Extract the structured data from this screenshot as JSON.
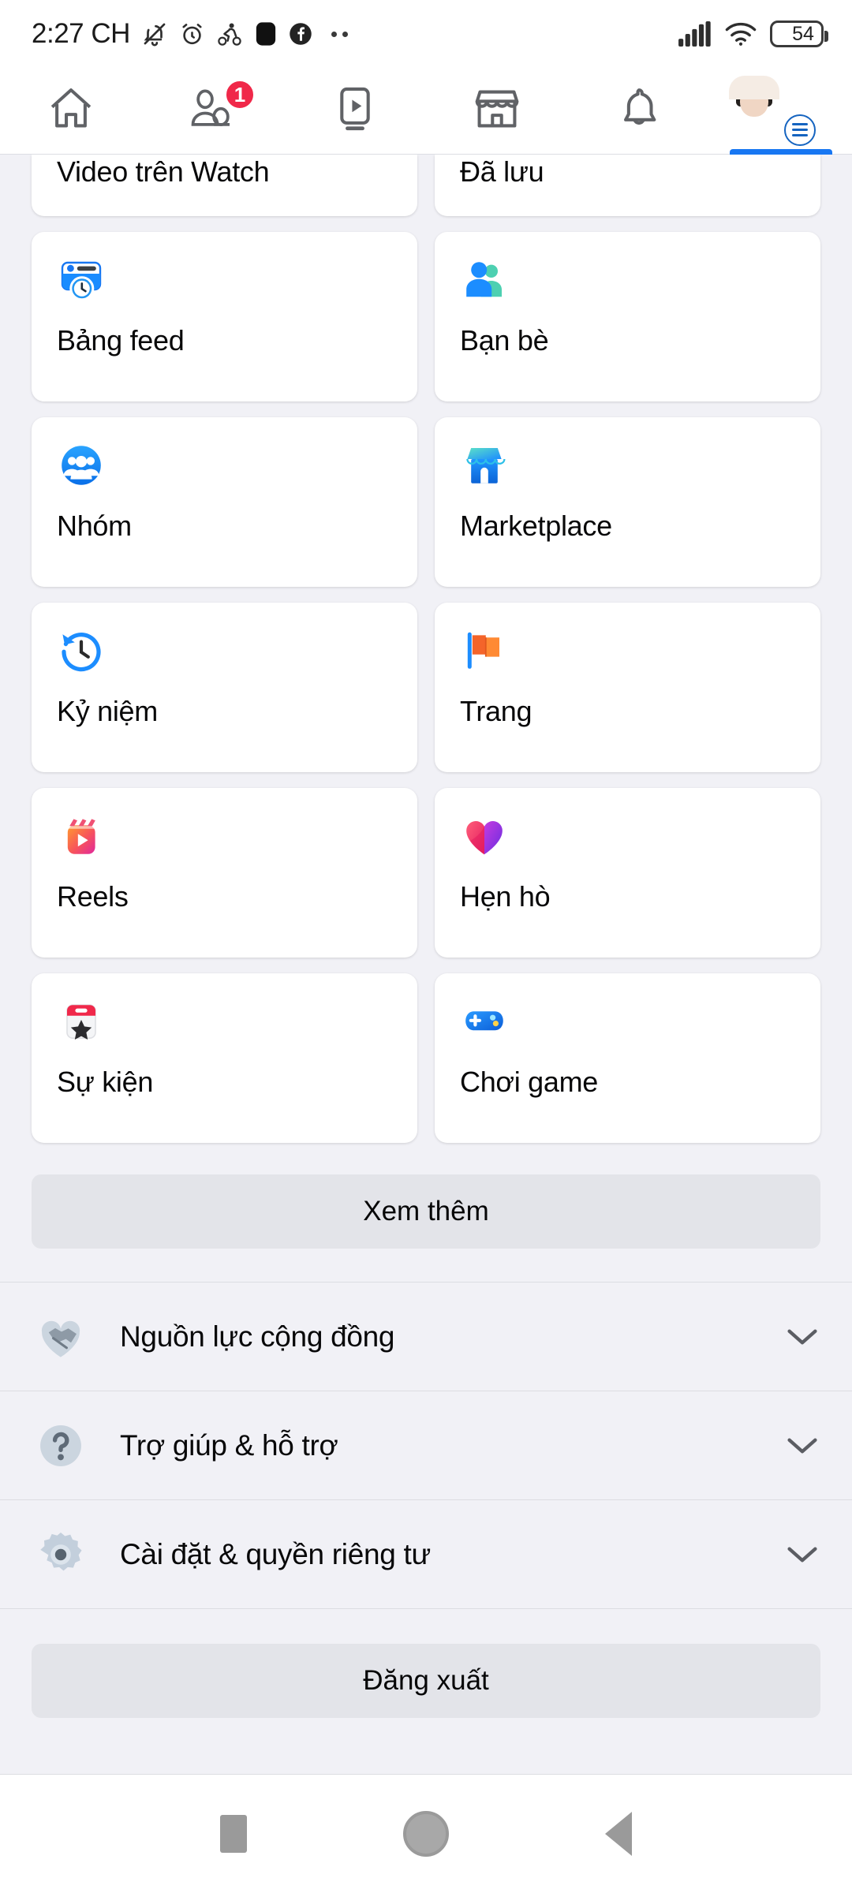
{
  "statusbar": {
    "time": "2:27 CH",
    "icons": [
      "bell-mute-icon",
      "alarm-clock-icon",
      "motorcycle-icon",
      "square-app-icon",
      "facebook-icon",
      "more-dots-icon"
    ],
    "signal": "signal-bars-icon",
    "wifi": "wifi-icon",
    "battery_percent": "54"
  },
  "topnav": {
    "tabs": [
      {
        "name": "home",
        "icon": "home-icon",
        "badge": null,
        "active": false
      },
      {
        "name": "friends",
        "icon": "friends-icon",
        "badge": "1",
        "active": false
      },
      {
        "name": "watch",
        "icon": "video-play-icon",
        "badge": null,
        "active": false
      },
      {
        "name": "marketplace",
        "icon": "store-icon",
        "badge": null,
        "active": false
      },
      {
        "name": "notifications",
        "icon": "bell-icon",
        "badge": null,
        "active": false
      },
      {
        "name": "menu",
        "icon": "avatar-menu-icon",
        "badge": null,
        "active": true
      }
    ]
  },
  "menu_grid": [
    {
      "label": "Video trên Watch",
      "icon": "watch-video-icon",
      "clipped": true
    },
    {
      "label": "Đã lưu",
      "icon": "saved-bookmark-icon",
      "clipped": true
    },
    {
      "label": "Bảng feed",
      "icon": "feeds-board-icon",
      "clipped": false
    },
    {
      "label": "Bạn bè",
      "icon": "friends-people-icon",
      "clipped": false
    },
    {
      "label": "Nhóm",
      "icon": "groups-icon",
      "clipped": false
    },
    {
      "label": "Marketplace",
      "icon": "marketplace-store-icon",
      "clipped": false
    },
    {
      "label": "Kỷ niệm",
      "icon": "memories-clock-icon",
      "clipped": false
    },
    {
      "label": "Trang",
      "icon": "pages-flag-icon",
      "clipped": false
    },
    {
      "label": "Reels",
      "icon": "reels-clapper-icon",
      "clipped": false
    },
    {
      "label": "Hẹn hò",
      "icon": "dating-heart-icon",
      "clipped": false
    },
    {
      "label": "Sự kiện",
      "icon": "events-calendar-icon",
      "clipped": false
    },
    {
      "label": "Chơi game",
      "icon": "gaming-controller-icon",
      "clipped": false
    }
  ],
  "see_more_label": "Xem thêm",
  "sections": [
    {
      "label": "Nguồn lực cộng đồng",
      "icon": "handshake-heart-icon",
      "chevron": "chevron-down-icon"
    },
    {
      "label": "Trợ giúp & hỗ trợ",
      "icon": "question-circle-icon",
      "chevron": "chevron-down-icon"
    },
    {
      "label": "Cài đặt & quyền riêng tư",
      "icon": "gear-icon",
      "chevron": "chevron-down-icon"
    }
  ],
  "logout_label": "Đăng xuất",
  "androidnav": {
    "recents": "square-recents-icon",
    "home": "circle-home-icon",
    "back": "triangle-back-icon"
  },
  "colors": {
    "accent": "#1877F2",
    "badge": "#F02849",
    "background": "#F1F1F6",
    "card": "#FFFFFF",
    "button": "#E3E4E9"
  }
}
